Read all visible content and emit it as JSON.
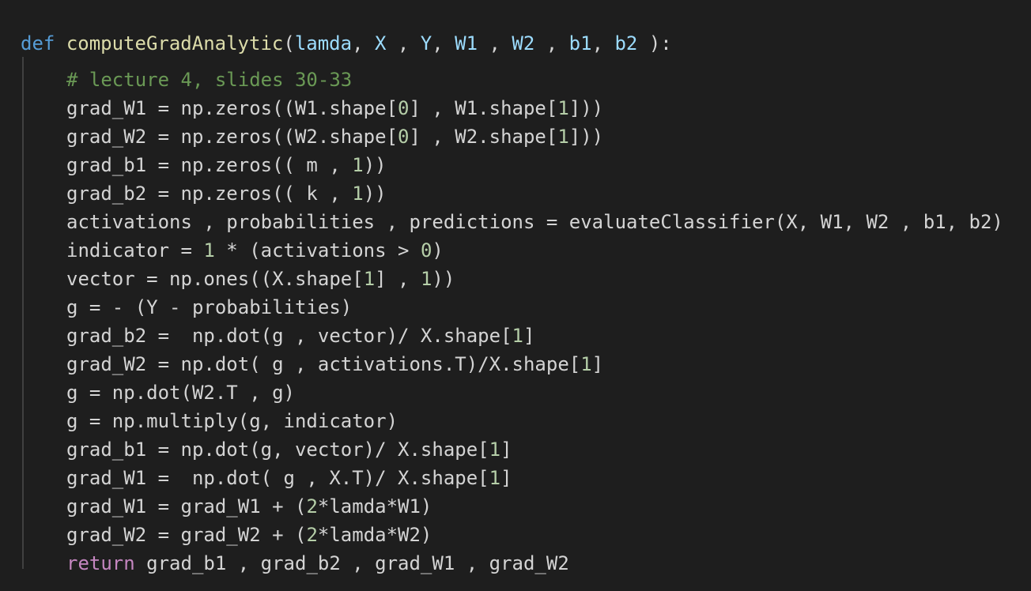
{
  "editor": {
    "theme": "dark",
    "colors": {
      "background": "#1e1e1e",
      "text": "#d4d4d4",
      "keyword": "#569cd6",
      "function": "#dcdcaa",
      "parameter": "#9cdcfe",
      "comment": "#6a9955",
      "number": "#b5cea8",
      "control": "#c586c0",
      "indent_guide": "#404040"
    }
  },
  "code": {
    "lines": [
      {
        "indent": 0,
        "tokens": [
          {
            "t": "def",
            "c": "kw"
          },
          {
            "t": " ",
            "c": "txt"
          },
          {
            "t": "computeGradAnalytic",
            "c": "fn"
          },
          {
            "t": "(",
            "c": "txt"
          },
          {
            "t": "lamda",
            "c": "var"
          },
          {
            "t": ", ",
            "c": "txt"
          },
          {
            "t": "X",
            "c": "var"
          },
          {
            "t": " , ",
            "c": "txt"
          },
          {
            "t": "Y",
            "c": "var"
          },
          {
            "t": ", ",
            "c": "txt"
          },
          {
            "t": "W1",
            "c": "var"
          },
          {
            "t": " , ",
            "c": "txt"
          },
          {
            "t": "W2",
            "c": "var"
          },
          {
            "t": " , ",
            "c": "txt"
          },
          {
            "t": "b1",
            "c": "var"
          },
          {
            "t": ", ",
            "c": "txt"
          },
          {
            "t": "b2",
            "c": "var"
          },
          {
            "t": " ):",
            "c": "txt"
          }
        ]
      },
      {
        "indent": 1,
        "tokens": [
          {
            "t": "# lecture 4, slides 30-33",
            "c": "com"
          }
        ]
      },
      {
        "indent": 1,
        "tokens": [
          {
            "t": "grad_W1 = np.zeros((W1.shape[",
            "c": "txt"
          },
          {
            "t": "0",
            "c": "num"
          },
          {
            "t": "] , W1.shape[",
            "c": "txt"
          },
          {
            "t": "1",
            "c": "num"
          },
          {
            "t": "]))",
            "c": "txt"
          }
        ]
      },
      {
        "indent": 1,
        "tokens": [
          {
            "t": "grad_W2 = np.zeros((W2.shape[",
            "c": "txt"
          },
          {
            "t": "0",
            "c": "num"
          },
          {
            "t": "] , W2.shape[",
            "c": "txt"
          },
          {
            "t": "1",
            "c": "num"
          },
          {
            "t": "]))",
            "c": "txt"
          }
        ]
      },
      {
        "indent": 1,
        "tokens": [
          {
            "t": "grad_b1 = np.zeros(( m , ",
            "c": "txt"
          },
          {
            "t": "1",
            "c": "num"
          },
          {
            "t": "))",
            "c": "txt"
          }
        ]
      },
      {
        "indent": 1,
        "tokens": [
          {
            "t": "grad_b2 = np.zeros(( k , ",
            "c": "txt"
          },
          {
            "t": "1",
            "c": "num"
          },
          {
            "t": "))",
            "c": "txt"
          }
        ]
      },
      {
        "indent": 1,
        "tokens": [
          {
            "t": "activations , probabilities , predictions = evaluateClassifier(X, W1, W2 , b1, b2)",
            "c": "txt"
          }
        ]
      },
      {
        "indent": 1,
        "tokens": [
          {
            "t": "indicator = ",
            "c": "txt"
          },
          {
            "t": "1",
            "c": "num"
          },
          {
            "t": " * (activations > ",
            "c": "txt"
          },
          {
            "t": "0",
            "c": "num"
          },
          {
            "t": ")",
            "c": "txt"
          }
        ]
      },
      {
        "indent": 1,
        "tokens": [
          {
            "t": "vector = np.ones((X.shape[",
            "c": "txt"
          },
          {
            "t": "1",
            "c": "num"
          },
          {
            "t": "] , ",
            "c": "txt"
          },
          {
            "t": "1",
            "c": "num"
          },
          {
            "t": "))",
            "c": "txt"
          }
        ]
      },
      {
        "indent": 1,
        "tokens": [
          {
            "t": "g = - (Y - probabilities)",
            "c": "txt"
          }
        ]
      },
      {
        "indent": 1,
        "tokens": [
          {
            "t": "grad_b2 =  np.dot(g , vector)/ X.shape[",
            "c": "txt"
          },
          {
            "t": "1",
            "c": "num"
          },
          {
            "t": "]",
            "c": "txt"
          }
        ]
      },
      {
        "indent": 1,
        "tokens": [
          {
            "t": "grad_W2 = np.dot( g , activations.T)/X.shape[",
            "c": "txt"
          },
          {
            "t": "1",
            "c": "num"
          },
          {
            "t": "]",
            "c": "txt"
          }
        ]
      },
      {
        "indent": 1,
        "tokens": [
          {
            "t": "g = np.dot(W2.T , g)",
            "c": "txt"
          }
        ]
      },
      {
        "indent": 1,
        "tokens": [
          {
            "t": "g = np.multiply(g, indicator)",
            "c": "txt"
          }
        ]
      },
      {
        "indent": 1,
        "tokens": [
          {
            "t": "grad_b1 = np.dot(g, vector)/ X.shape[",
            "c": "txt"
          },
          {
            "t": "1",
            "c": "num"
          },
          {
            "t": "]",
            "c": "txt"
          }
        ]
      },
      {
        "indent": 1,
        "tokens": [
          {
            "t": "grad_W1 =  np.dot( g , X.T)/ X.shape[",
            "c": "txt"
          },
          {
            "t": "1",
            "c": "num"
          },
          {
            "t": "]",
            "c": "txt"
          }
        ]
      },
      {
        "indent": 1,
        "tokens": [
          {
            "t": "grad_W1 = grad_W1 + (",
            "c": "txt"
          },
          {
            "t": "2",
            "c": "num"
          },
          {
            "t": "*lamda*W1)",
            "c": "txt"
          }
        ]
      },
      {
        "indent": 1,
        "tokens": [
          {
            "t": "grad_W2 = grad_W2 + (",
            "c": "txt"
          },
          {
            "t": "2",
            "c": "num"
          },
          {
            "t": "*lamda*W2)",
            "c": "txt"
          }
        ]
      },
      {
        "indent": 1,
        "tokens": [
          {
            "t": "return",
            "c": "ctl"
          },
          {
            "t": " grad_b1 , grad_b2 , grad_W1 , grad_W2",
            "c": "txt"
          }
        ]
      }
    ]
  }
}
